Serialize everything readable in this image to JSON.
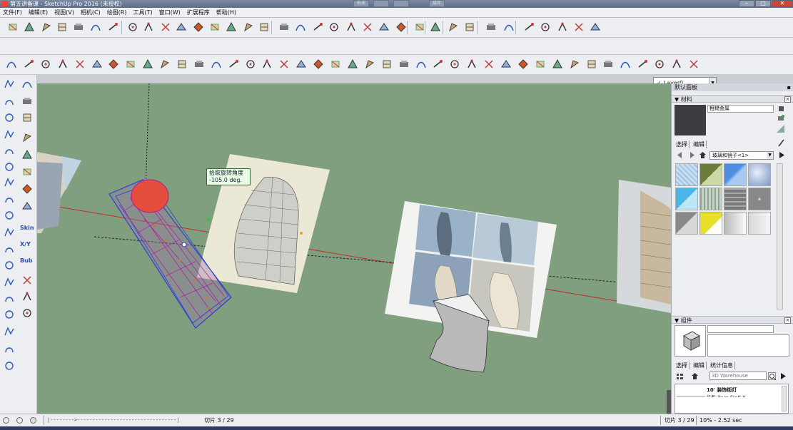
{
  "window": {
    "title": "第五讲备课 - SketchUp Pro 2016 (未授权)",
    "middle_buttons": [
      "右击",
      "",
      "",
      "结年"
    ],
    "controls": [
      "–",
      "□",
      "✕"
    ]
  },
  "menubar": [
    "文件(F)",
    "编辑(E)",
    "视图(V)",
    "相机(C)",
    "绘图(R)",
    "工具(T)",
    "窗口(W)",
    "扩展程序",
    "帮助(H)"
  ],
  "layer": {
    "check": "✓",
    "value": "Layer0"
  },
  "left_tools": {
    "skin_label": "Skin",
    "xy_label": "X/Y",
    "bub_label": "Bub"
  },
  "viewport": {
    "tooltip_line1": "拾取旋转角度",
    "tooltip_line2": "-105.0 deg."
  },
  "right_panel": {
    "tray_title": "默认面板",
    "materials": {
      "title": "材料",
      "name_value": "粗糙金属",
      "tabs": [
        "选择",
        "编辑"
      ],
      "library_value": "玻璃和镜子<1>"
    },
    "components": {
      "title": "组件",
      "tabs": [
        "选择",
        "编辑",
        "统计信息"
      ],
      "search_placeholder": "3D Warehouse",
      "result_title": "10' 装饰街灯",
      "result_author": "作者: Ryan Scott H."
    }
  },
  "statusbar": {
    "slide_left": "切片 3 / 29",
    "slide_right": "切片 3 / 29",
    "progress": "10% - 2.52 sec"
  },
  "colors": {
    "viewport_bg": "#809f7e",
    "selection_blue": "#2c3fd6",
    "magenta_mesh": "#b4189c",
    "axis_red": "#c42b2b"
  }
}
